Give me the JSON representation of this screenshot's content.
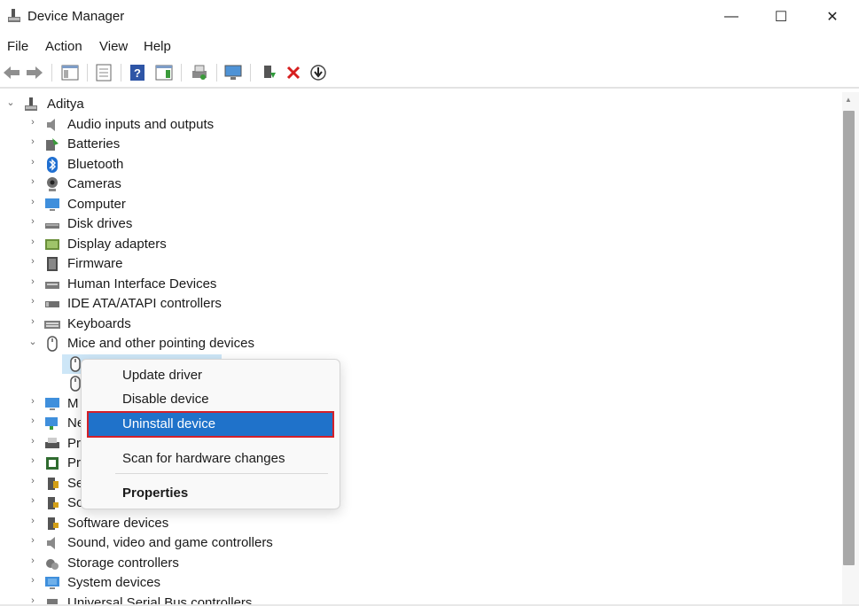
{
  "window": {
    "title": "Device Manager",
    "minimize": "—",
    "maximize": "☐",
    "close": "✕"
  },
  "menu": [
    "File",
    "Action",
    "View",
    "Help"
  ],
  "tree": {
    "root": "Aditya",
    "categories": [
      {
        "label": "Audio inputs and outputs",
        "icon": "speaker-icon"
      },
      {
        "label": "Batteries",
        "icon": "battery-icon"
      },
      {
        "label": "Bluetooth",
        "icon": "bluetooth-icon"
      },
      {
        "label": "Cameras",
        "icon": "camera-icon"
      },
      {
        "label": "Computer",
        "icon": "monitor-icon"
      },
      {
        "label": "Disk drives",
        "icon": "disk-drive-icon"
      },
      {
        "label": "Display adapters",
        "icon": "display-adapter-icon"
      },
      {
        "label": "Firmware",
        "icon": "firmware-icon"
      },
      {
        "label": "Human Interface Devices",
        "icon": "hid-icon"
      },
      {
        "label": "IDE ATA/ATAPI controllers",
        "icon": "ide-controller-icon"
      },
      {
        "label": "Keyboards",
        "icon": "keyboard-icon"
      },
      {
        "label": "Mice and other pointing devices",
        "icon": "mouse-icon"
      }
    ],
    "partial_rows": [
      "M",
      "Ne",
      "Pr",
      "Pr",
      "Se",
      "So"
    ],
    "lower_categories": [
      {
        "label": "Software devices",
        "icon": "software-icon"
      },
      {
        "label": "Sound, video and game controllers",
        "icon": "sound-icon"
      },
      {
        "label": "Storage controllers",
        "icon": "storage-icon"
      },
      {
        "label": "System devices",
        "icon": "system-icon"
      },
      {
        "label": "Universal Serial Bus controllers",
        "icon": "usb-icon"
      }
    ]
  },
  "context_menu": {
    "update": "Update driver",
    "disable": "Disable device",
    "uninstall": "Uninstall device",
    "scan": "Scan for hardware changes",
    "properties": "Properties"
  }
}
